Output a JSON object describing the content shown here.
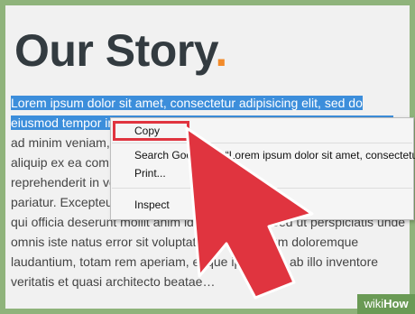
{
  "heading": {
    "text": "Our Story",
    "accent": "."
  },
  "paragraph": {
    "selected_lines": [
      "Lorem ipsum dolor sit amet, consectetur adipisicing elit, sed do",
      "eiusmod tempor incididunt ut labore et dolore magna aliqua. Ut enim"
    ],
    "lines": [
      "ad minim veniam, quis nostrud exercitation ullamco laboris nisi ut",
      "aliquip ex ea commodo consequat. Duis aute irure dolor in",
      "reprehenderit in voluptate velit esse cillum dolore eu fugiat nulla",
      "pariatur. Excepteur sint occaecat cupidatat non proident, sunt in culpa",
      "qui officia deserunt mollit anim id est laborum. Sed ut perspiciatis unde",
      "omnis iste natus error sit voluptatem accusantium doloremque",
      "laudantium, totam rem aperiam, eaque ipsa quae ab illo inventore",
      "veritatis et quasi architecto beatae…"
    ]
  },
  "context_menu": {
    "copy": "Copy",
    "search": "Search Google for “Lorem ipsum dolor sit amet, consectetur...”",
    "print": "Print...",
    "inspect": "Inspect"
  },
  "watermark": {
    "prefix": "wiki",
    "suffix": "How"
  },
  "colors": {
    "selection": "#3c8edb",
    "heading_accent": "#f28b2a",
    "arrow": "#e0343f",
    "frame": "#8fb37b"
  }
}
